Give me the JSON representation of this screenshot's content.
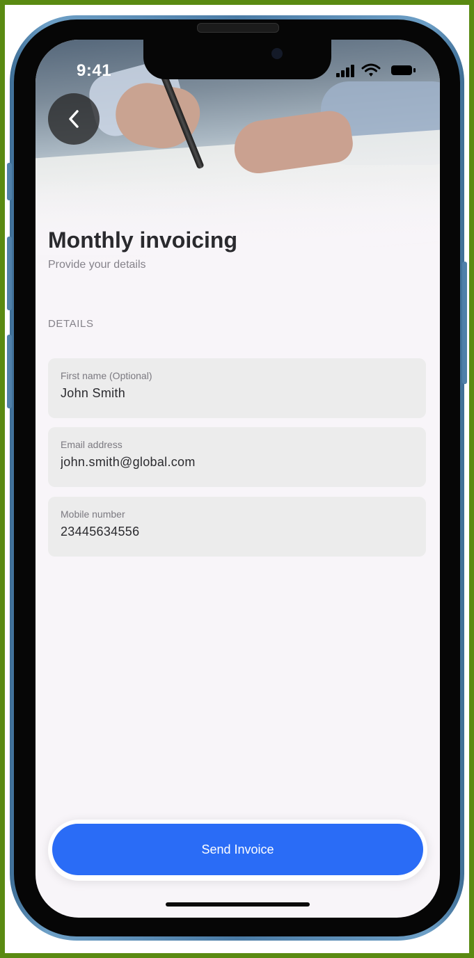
{
  "status_bar": {
    "time": "9:41"
  },
  "header": {
    "back_icon": "chevron-left-icon",
    "title": "Monthly invoicing",
    "subtitle": "Provide your details"
  },
  "section": {
    "label": "DETAILS"
  },
  "fields": [
    {
      "label": "First name (Optional)",
      "value": "John Smith"
    },
    {
      "label": "Email address",
      "value": "john.smith@global.com"
    },
    {
      "label": "Mobile number",
      "value": "23445634556"
    }
  ],
  "actions": {
    "send_label": "Send Invoice"
  },
  "colors": {
    "primary": "#2a6cf6",
    "background": "#f8f5f9",
    "field_bg": "#ececec",
    "frame": "#5a8a12",
    "phone_body": "#4f80a9"
  }
}
